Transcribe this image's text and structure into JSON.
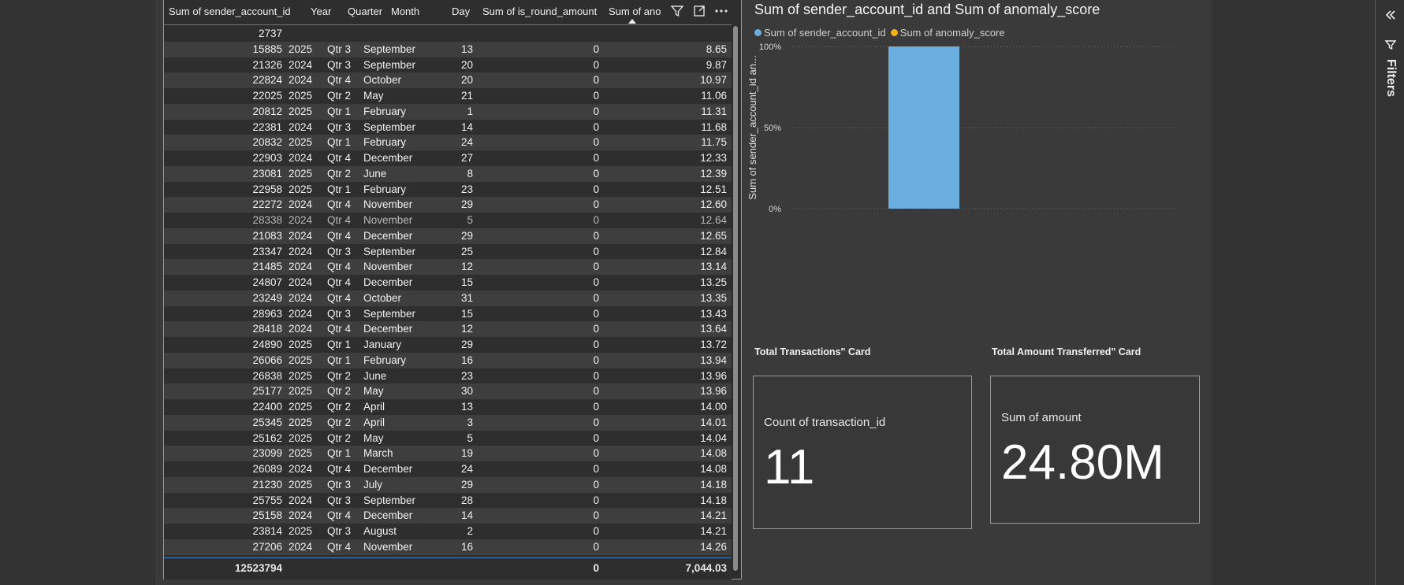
{
  "table": {
    "headers": {
      "sender": "Sum of sender_account_id",
      "year": "Year",
      "quarter": "Quarter",
      "month": "Month",
      "day": "Day",
      "round": "Sum of is_round_amount",
      "anomaly": "Sum of ano"
    },
    "rows": [
      {
        "sender": "2737",
        "year": "",
        "quarter": "",
        "month": "",
        "day": "",
        "round": "",
        "anomaly": ""
      },
      {
        "sender": "15885",
        "year": "2025",
        "quarter": "Qtr 3",
        "month": "September",
        "day": "13",
        "round": "0",
        "anomaly": "8.65"
      },
      {
        "sender": "21326",
        "year": "2024",
        "quarter": "Qtr 3",
        "month": "September",
        "day": "20",
        "round": "0",
        "anomaly": "9.87"
      },
      {
        "sender": "22824",
        "year": "2024",
        "quarter": "Qtr 4",
        "month": "October",
        "day": "20",
        "round": "0",
        "anomaly": "10.97"
      },
      {
        "sender": "22025",
        "year": "2025",
        "quarter": "Qtr 2",
        "month": "May",
        "day": "21",
        "round": "0",
        "anomaly": "11.06"
      },
      {
        "sender": "20812",
        "year": "2025",
        "quarter": "Qtr 1",
        "month": "February",
        "day": "1",
        "round": "0",
        "anomaly": "11.31"
      },
      {
        "sender": "22381",
        "year": "2024",
        "quarter": "Qtr 3",
        "month": "September",
        "day": "14",
        "round": "0",
        "anomaly": "11.68"
      },
      {
        "sender": "20832",
        "year": "2025",
        "quarter": "Qtr 1",
        "month": "February",
        "day": "24",
        "round": "0",
        "anomaly": "11.75"
      },
      {
        "sender": "22903",
        "year": "2024",
        "quarter": "Qtr 4",
        "month": "December",
        "day": "27",
        "round": "0",
        "anomaly": "12.33"
      },
      {
        "sender": "23081",
        "year": "2025",
        "quarter": "Qtr 2",
        "month": "June",
        "day": "8",
        "round": "0",
        "anomaly": "12.39"
      },
      {
        "sender": "22958",
        "year": "2025",
        "quarter": "Qtr 1",
        "month": "February",
        "day": "23",
        "round": "0",
        "anomaly": "12.51"
      },
      {
        "sender": "22272",
        "year": "2024",
        "quarter": "Qtr 4",
        "month": "November",
        "day": "29",
        "round": "0",
        "anomaly": "12.60"
      },
      {
        "sender": "28338",
        "year": "2024",
        "quarter": "Qtr 4",
        "month": "November",
        "day": "5",
        "round": "0",
        "anomaly": "12.64"
      },
      {
        "sender": "21083",
        "year": "2024",
        "quarter": "Qtr 4",
        "month": "December",
        "day": "29",
        "round": "0",
        "anomaly": "12.65"
      },
      {
        "sender": "23347",
        "year": "2024",
        "quarter": "Qtr 3",
        "month": "September",
        "day": "25",
        "round": "0",
        "anomaly": "12.84"
      },
      {
        "sender": "21485",
        "year": "2024",
        "quarter": "Qtr 4",
        "month": "November",
        "day": "12",
        "round": "0",
        "anomaly": "13.14"
      },
      {
        "sender": "24807",
        "year": "2024",
        "quarter": "Qtr 4",
        "month": "December",
        "day": "15",
        "round": "0",
        "anomaly": "13.25"
      },
      {
        "sender": "23249",
        "year": "2024",
        "quarter": "Qtr 4",
        "month": "October",
        "day": "31",
        "round": "0",
        "anomaly": "13.35"
      },
      {
        "sender": "28963",
        "year": "2024",
        "quarter": "Qtr 3",
        "month": "September",
        "day": "15",
        "round": "0",
        "anomaly": "13.43"
      },
      {
        "sender": "28418",
        "year": "2024",
        "quarter": "Qtr 4",
        "month": "December",
        "day": "12",
        "round": "0",
        "anomaly": "13.64"
      },
      {
        "sender": "24890",
        "year": "2025",
        "quarter": "Qtr 1",
        "month": "January",
        "day": "29",
        "round": "0",
        "anomaly": "13.72"
      },
      {
        "sender": "26066",
        "year": "2025",
        "quarter": "Qtr 1",
        "month": "February",
        "day": "16",
        "round": "0",
        "anomaly": "13.94"
      },
      {
        "sender": "26838",
        "year": "2025",
        "quarter": "Qtr 2",
        "month": "June",
        "day": "23",
        "round": "0",
        "anomaly": "13.96"
      },
      {
        "sender": "25177",
        "year": "2025",
        "quarter": "Qtr 2",
        "month": "May",
        "day": "30",
        "round": "0",
        "anomaly": "13.96"
      },
      {
        "sender": "22400",
        "year": "2025",
        "quarter": "Qtr 2",
        "month": "April",
        "day": "13",
        "round": "0",
        "anomaly": "14.00"
      },
      {
        "sender": "25345",
        "year": "2025",
        "quarter": "Qtr 2",
        "month": "April",
        "day": "3",
        "round": "0",
        "anomaly": "14.01"
      },
      {
        "sender": "25162",
        "year": "2025",
        "quarter": "Qtr 2",
        "month": "May",
        "day": "5",
        "round": "0",
        "anomaly": "14.04"
      },
      {
        "sender": "23099",
        "year": "2025",
        "quarter": "Qtr 1",
        "month": "March",
        "day": "19",
        "round": "0",
        "anomaly": "14.08"
      },
      {
        "sender": "26089",
        "year": "2024",
        "quarter": "Qtr 4",
        "month": "December",
        "day": "24",
        "round": "0",
        "anomaly": "14.08"
      },
      {
        "sender": "21230",
        "year": "2025",
        "quarter": "Qtr 3",
        "month": "July",
        "day": "29",
        "round": "0",
        "anomaly": "14.18"
      },
      {
        "sender": "25755",
        "year": "2024",
        "quarter": "Qtr 3",
        "month": "September",
        "day": "28",
        "round": "0",
        "anomaly": "14.18"
      },
      {
        "sender": "25158",
        "year": "2024",
        "quarter": "Qtr 4",
        "month": "December",
        "day": "14",
        "round": "0",
        "anomaly": "14.21"
      },
      {
        "sender": "23814",
        "year": "2025",
        "quarter": "Qtr 3",
        "month": "August",
        "day": "2",
        "round": "0",
        "anomaly": "14.21"
      },
      {
        "sender": "27206",
        "year": "2024",
        "quarter": "Qtr 4",
        "month": "November",
        "day": "16",
        "round": "0",
        "anomaly": "14.26"
      }
    ],
    "total": {
      "sender": "12523794",
      "round": "0",
      "anomaly": "7,044.03"
    }
  },
  "chart": {
    "title": "Sum of sender_account_id and Sum of anomaly_score",
    "legend": [
      {
        "label": "Sum of sender_account_id",
        "color": "#6aaee0"
      },
      {
        "label": "Sum of anomaly_score",
        "color": "#f2b01e"
      }
    ],
    "y_axis_label": "Sum of sender_account_id an..."
  },
  "chart_data": {
    "type": "bar",
    "categories": [
      ""
    ],
    "series": [
      {
        "name": "Sum of sender_account_id",
        "values": [
          100
        ]
      }
    ],
    "ylim": [
      0,
      100
    ],
    "yticks": [
      "0%",
      "50%",
      "100%"
    ],
    "ylabel": "Sum of sender_account_id an...",
    "title": "Sum of sender_account_id and Sum of anomaly_score",
    "legend_position": "top-left",
    "grid": true
  },
  "cards": {
    "transactions": {
      "title": "Total Transactions\" Card",
      "label": "Count of transaction_id",
      "value": "11"
    },
    "amount": {
      "title": "Total Amount Transferred\" Card",
      "label": "Sum of amount",
      "value": "24.80M"
    }
  },
  "filters_pane": {
    "label": "Filters"
  },
  "colors": {
    "bar": "#6aaee0",
    "accent_line": "#4a7cc0",
    "background": "#333333"
  }
}
